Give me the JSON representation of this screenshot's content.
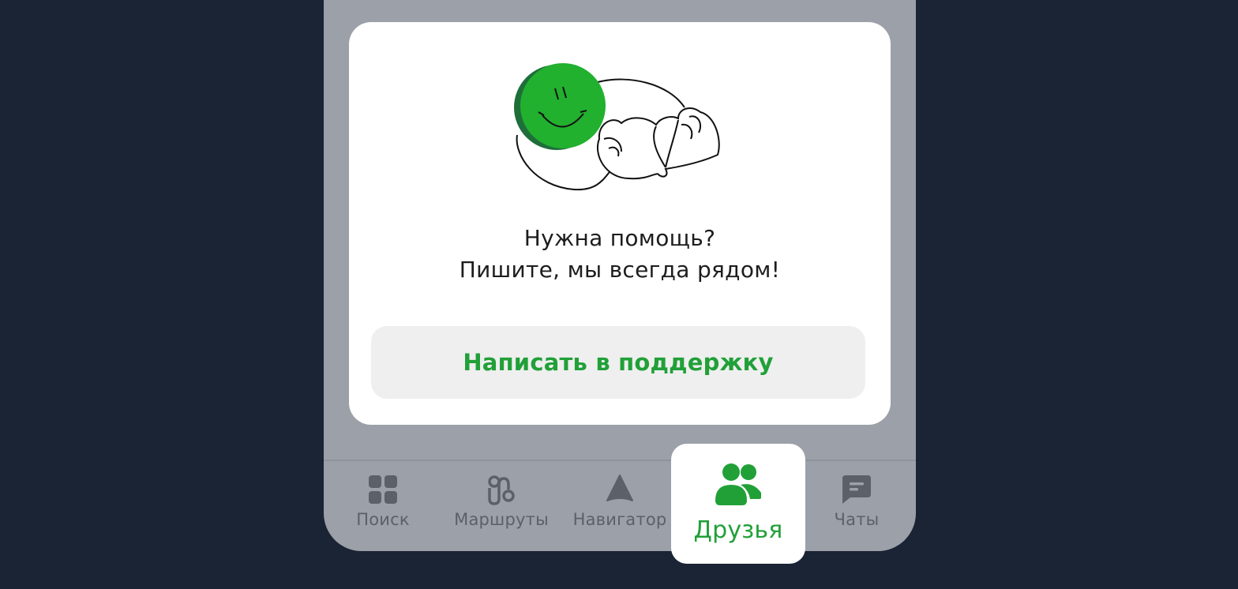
{
  "card": {
    "message_line1": "Нужна помощь?",
    "message_line2": "Пишите, мы всегда рядом!",
    "support_button": "Написать в поддержку",
    "illustration": "smiley-heart-hands"
  },
  "tabbar": {
    "items": [
      {
        "label": "Поиск",
        "icon": "grid-icon"
      },
      {
        "label": "Маршруты",
        "icon": "route-icon"
      },
      {
        "label": "Навигатор",
        "icon": "navigator-icon"
      },
      {
        "label": "Друзья",
        "icon": "friends-icon",
        "active": true
      },
      {
        "label": "Чаты",
        "icon": "chat-icon"
      }
    ]
  },
  "colors": {
    "accent": "#21a038",
    "background": "#1b2434",
    "panel": "#9ca0a8",
    "inactive": "#5c6068"
  }
}
